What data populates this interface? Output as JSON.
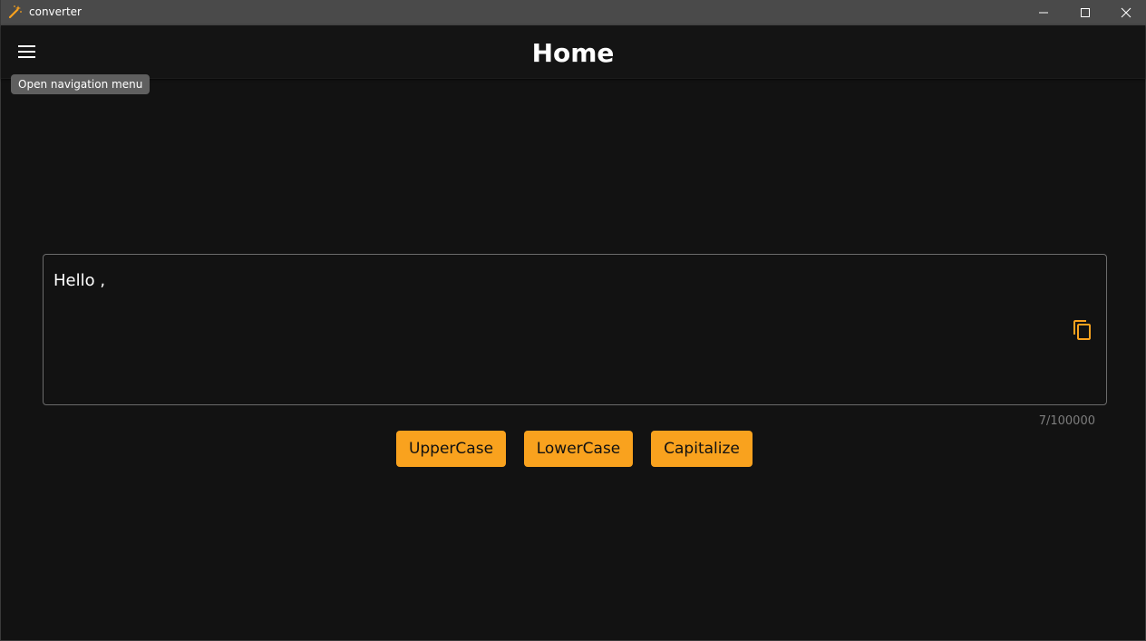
{
  "window": {
    "title": "converter",
    "icon": "magic-wand-icon",
    "controls": {
      "minimize": "minimize-icon",
      "maximize": "maximize-icon",
      "close": "close-icon"
    }
  },
  "appbar": {
    "title": "Home",
    "menu_icon": "hamburger-menu-icon",
    "tooltip": "Open navigation menu"
  },
  "editor": {
    "value": "Hello ,",
    "counter": "7/100000",
    "copy_icon": "copy-icon"
  },
  "actions": {
    "uppercase": "UpperCase",
    "lowercase": "LowerCase",
    "capitalize": "Capitalize"
  },
  "colors": {
    "accent": "#f9a21e",
    "background": "#121212",
    "titlebar": "#4a4a4a",
    "tooltip": "#5f5f5f"
  }
}
